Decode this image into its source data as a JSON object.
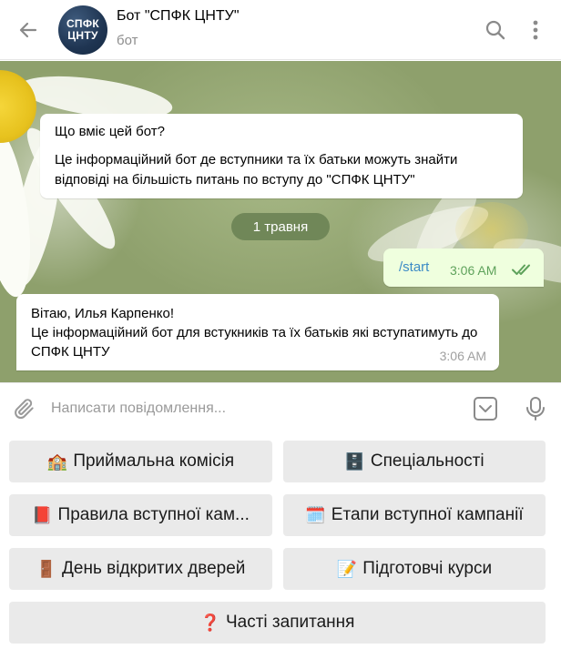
{
  "header": {
    "title": "Бот \"СПФК ЦНТУ\"",
    "subtitle": "бот",
    "avatar_line1": "СПФК",
    "avatar_line2": "ЦНТУ",
    "back_icon": "arrow-left-icon",
    "search_icon": "search-icon",
    "menu_icon": "more-vertical-icon"
  },
  "chat": {
    "info": {
      "title": "Що вміє цей бот?",
      "text": "Це інформаційний бот де вступники та їх батьки можуть знайти відповіді на більшість питань по вступу до \"СПФК ЦНТУ\""
    },
    "date_label": "1 травня",
    "messages": [
      {
        "direction": "out",
        "text": "/start",
        "time": "3:06 AM",
        "status_icon": "double-check-icon"
      },
      {
        "direction": "in",
        "lines": [
          "Вітаю, Илья Карпенко!",
          "Це інформаційний бот для встукників та їх батьків які вступатимуть до СПФК ЦНТУ"
        ],
        "time": "3:06 AM"
      }
    ]
  },
  "input": {
    "placeholder": "Написати повідомлення...",
    "attach_icon": "paperclip-icon",
    "keyboard_icon": "keyboard-toggle-icon",
    "mic_icon": "microphone-icon"
  },
  "keyboard": {
    "buttons": [
      {
        "emoji": "🏫",
        "label": "Приймальна комісія"
      },
      {
        "emoji": "🗄️",
        "label": "Спеціальності"
      },
      {
        "emoji": "📕",
        "label": "Правила вступної кам..."
      },
      {
        "emoji": "🗓️",
        "label": "Етапи вступної кампанії"
      },
      {
        "emoji": "🚪",
        "label": "День відкритих дверей"
      },
      {
        "emoji": "📝",
        "label": "Підготовчі курси"
      },
      {
        "emoji": "❓",
        "label": "Часті запитання"
      }
    ]
  },
  "colors": {
    "outgoing_bubble": "#efffde",
    "link_text": "#3c8bc6",
    "outgoing_time": "#5ea25b",
    "keyboard_button": "#eaeaea",
    "date_pill": "#688052"
  }
}
